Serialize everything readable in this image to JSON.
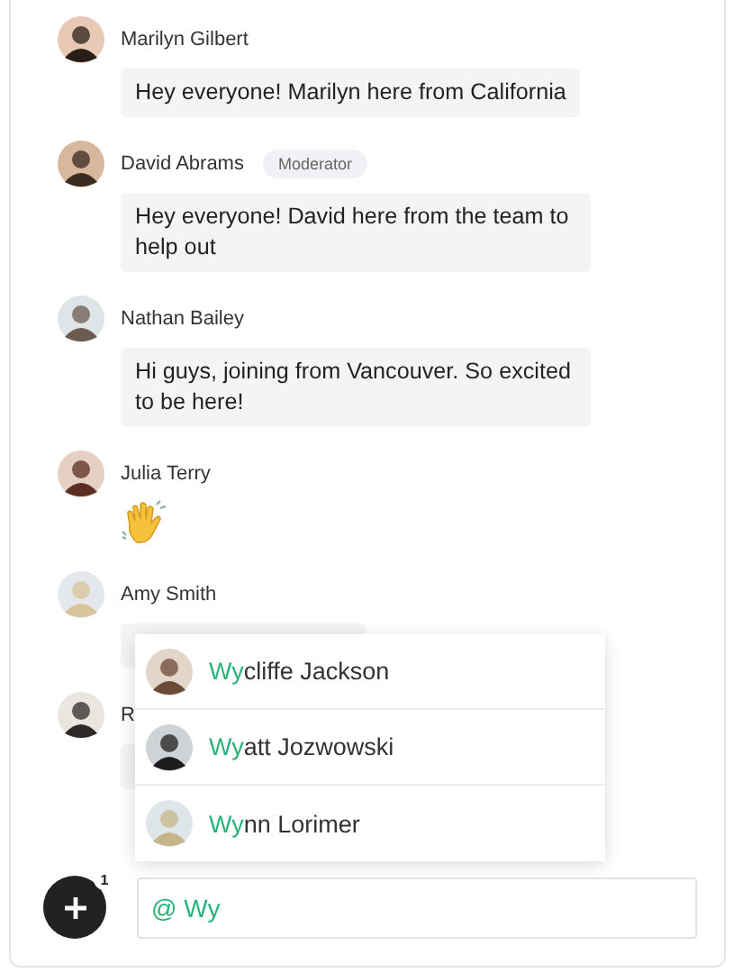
{
  "messages": [
    {
      "author": "Marilyn Gilbert",
      "kind": "text",
      "text": "Hey everyone! Marilyn here from California"
    },
    {
      "author": "David Abrams",
      "badge": "Moderator",
      "kind": "text",
      "text": "Hey everyone! David here from the team to help out"
    },
    {
      "author": "Nathan Bailey",
      "kind": "text",
      "text": "Hi guys, joining from Vancouver. So excited to be here!"
    },
    {
      "author": "Julia Terry",
      "kind": "wave"
    },
    {
      "author": "Amy Smith",
      "kind": "hidden"
    },
    {
      "author": "R",
      "kind": "hidden"
    }
  ],
  "mention_menu": [
    {
      "highlight": "Wy",
      "rest": "cliffe Jackson"
    },
    {
      "highlight": "Wy",
      "rest": "att Jozwowski"
    },
    {
      "highlight": "Wy",
      "rest": "nn Lorimer"
    }
  ],
  "composer": {
    "value": "@ Wy",
    "badge": "1"
  }
}
